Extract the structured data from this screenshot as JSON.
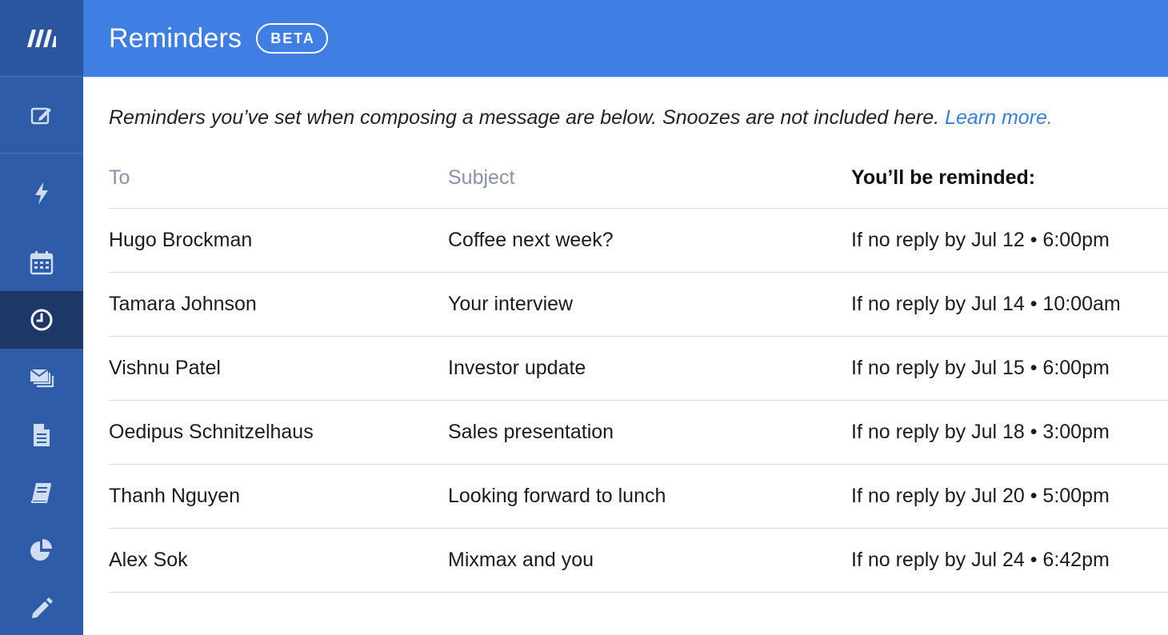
{
  "sidebar": {
    "items": [
      {
        "name": "compose",
        "icon": "compose-icon"
      },
      {
        "name": "quick",
        "icon": "lightning-icon"
      },
      {
        "name": "calendar",
        "icon": "calendar-icon"
      },
      {
        "name": "reminders",
        "icon": "clock-icon",
        "active": true
      },
      {
        "name": "sequences",
        "icon": "stacked-mail-icon"
      },
      {
        "name": "templates",
        "icon": "document-icon"
      },
      {
        "name": "rules",
        "icon": "book-icon"
      },
      {
        "name": "analytics",
        "icon": "pie-chart-icon"
      },
      {
        "name": "edit",
        "icon": "pencil-icon"
      }
    ]
  },
  "header": {
    "title": "Reminders",
    "badge": "BETA"
  },
  "intro": {
    "text": "Reminders you’ve set when composing a message are below. Snoozes are not included here.",
    "link": "Learn more."
  },
  "table": {
    "columns": [
      "To",
      "Subject",
      "You’ll be reminded:"
    ],
    "rows": [
      {
        "to": "Hugo Brockman",
        "subject": "Coffee next week?",
        "remind": "If no reply by Jul 12 • 6:00pm"
      },
      {
        "to": "Tamara Johnson",
        "subject": "Your interview",
        "remind": "If no reply by Jul 14 • 10:00am"
      },
      {
        "to": "Vishnu Patel",
        "subject": "Investor update",
        "remind": "If no reply by Jul 15 • 6:00pm"
      },
      {
        "to": "Oedipus Schnitzelhaus",
        "subject": "Sales presentation",
        "remind": "If no reply by Jul 18 • 3:00pm"
      },
      {
        "to": "Thanh Nguyen",
        "subject": "Looking forward to lunch",
        "remind": "If no reply by Jul 20 • 5:00pm"
      },
      {
        "to": "Alex Sok",
        "subject": "Mixmax and you",
        "remind": "If no reply by Jul 24 • 6:42pm"
      }
    ]
  },
  "colors": {
    "header": "#3f7fe3",
    "sidebar": "#2f5ca8",
    "sidebar_active": "#1d3866",
    "link": "#3a7fd6"
  }
}
